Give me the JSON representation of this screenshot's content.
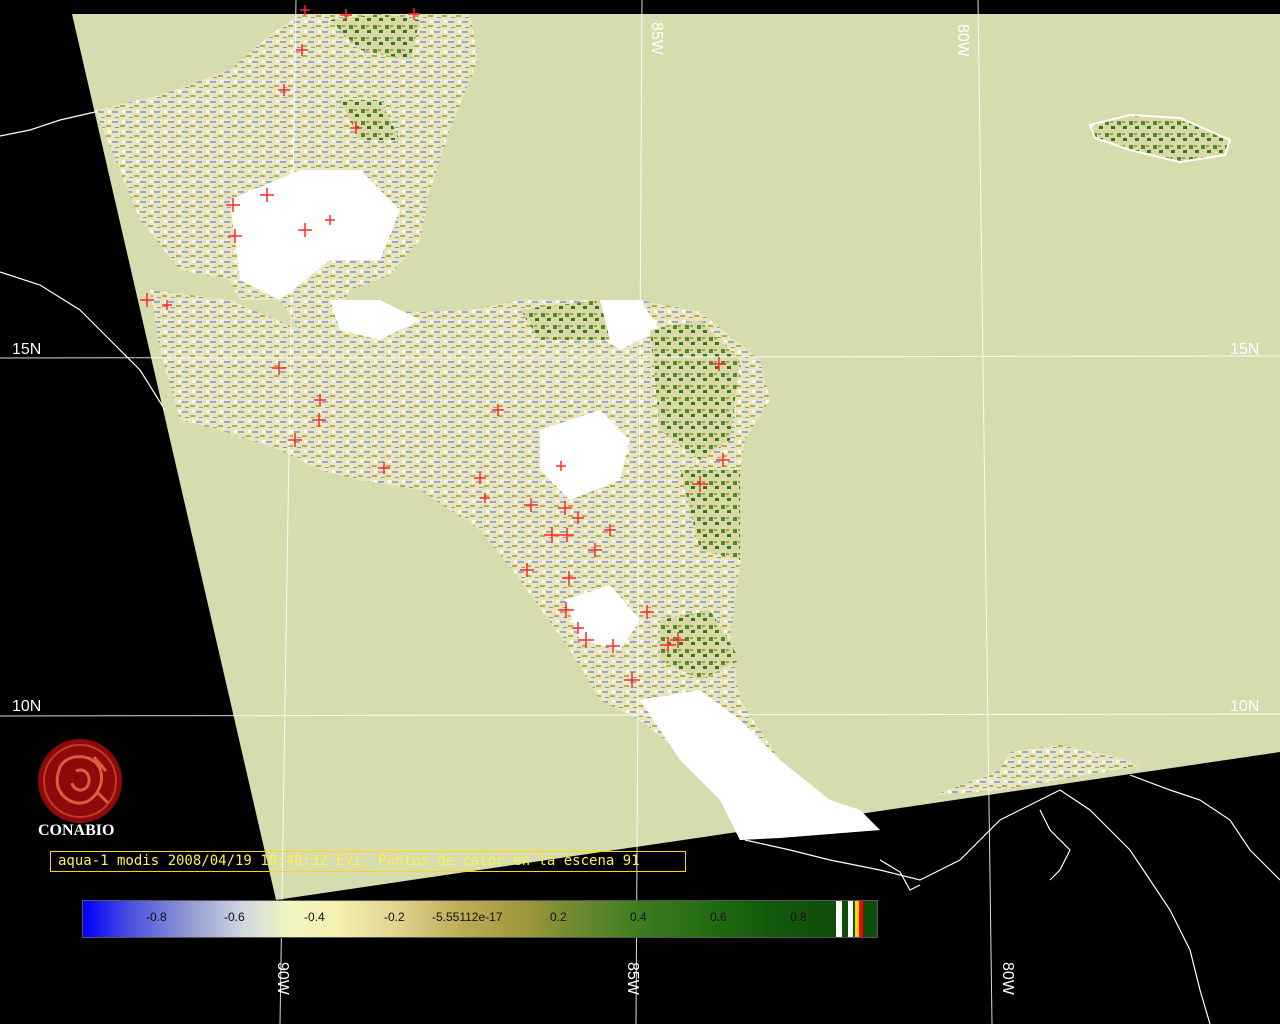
{
  "map": {
    "lat_labels": [
      "15N",
      "10N"
    ],
    "lon_labels": [
      "85W",
      "80W",
      "90W"
    ],
    "colors": {
      "background": "#000000",
      "ocean": "#d6dcae",
      "grid": "#ffffff",
      "fire_marker": "#ff2a2a",
      "title_box": "#ffd700"
    }
  },
  "logo": {
    "text": "CONABIO",
    "icon": "conabio-seal-icon"
  },
  "title": {
    "text": "aqua-1 modis 2008/04/19 18:48:32 Evi, Puntos de calor en la escena 91"
  },
  "colorbar": {
    "ticks": [
      "-0.8",
      "-0.6",
      "-0.4",
      "-0.2",
      "-5.55112e-17",
      "0.2",
      "0.4",
      "0.6",
      "0.8"
    ],
    "end_swatches": [
      "#ffffff",
      "#ffffff",
      "#ffd700",
      "#ff0000"
    ]
  }
}
